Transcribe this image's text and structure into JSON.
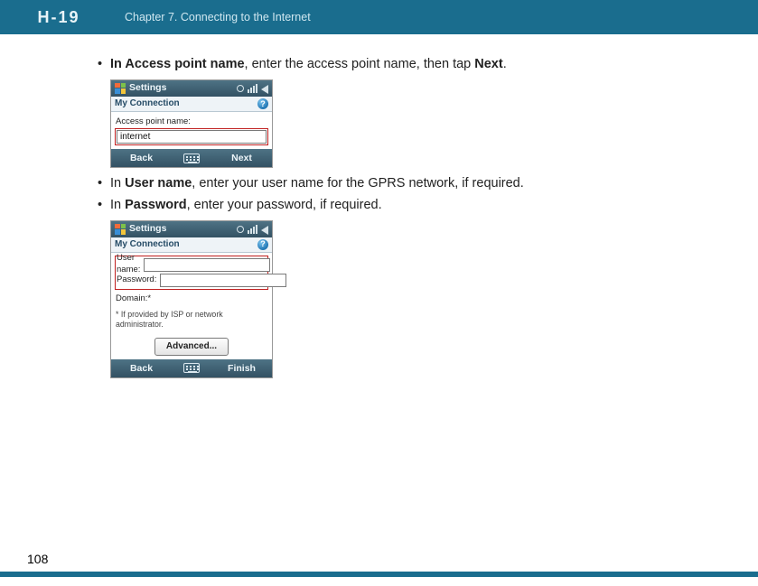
{
  "header": {
    "logo_text": "H-19",
    "chapter": "Chapter 7. Connecting to the Internet"
  },
  "page_number": "108",
  "bullets": {
    "apn_pre_bold": "In Access point name",
    "apn_rest": ", enter the access point name, then tap ",
    "apn_tail_bold": "Next",
    "apn_period": ".",
    "user_pre": "In ",
    "user_bold": "User name",
    "user_rest": ", enter your user name for the GPRS network, if required.",
    "pw_pre": "In ",
    "pw_bold": "Password",
    "pw_rest": ", enter your password, if required."
  },
  "phone1": {
    "top_title": "Settings",
    "sub_title": "My Connection",
    "help_glyph": "?",
    "apn_label": "Access point name:",
    "apn_value": "internet",
    "soft_left": "Back",
    "soft_right": "Next"
  },
  "phone2": {
    "top_title": "Settings",
    "sub_title": "My Connection",
    "help_glyph": "?",
    "user_label": "User name:",
    "user_value": "",
    "pw_label": "Password:",
    "pw_value": "",
    "domain_label": "Domain:*",
    "footnote": "* If provided by ISP or network administrator.",
    "advanced_label": "Advanced...",
    "soft_left": "Back",
    "soft_right": "Finish"
  }
}
